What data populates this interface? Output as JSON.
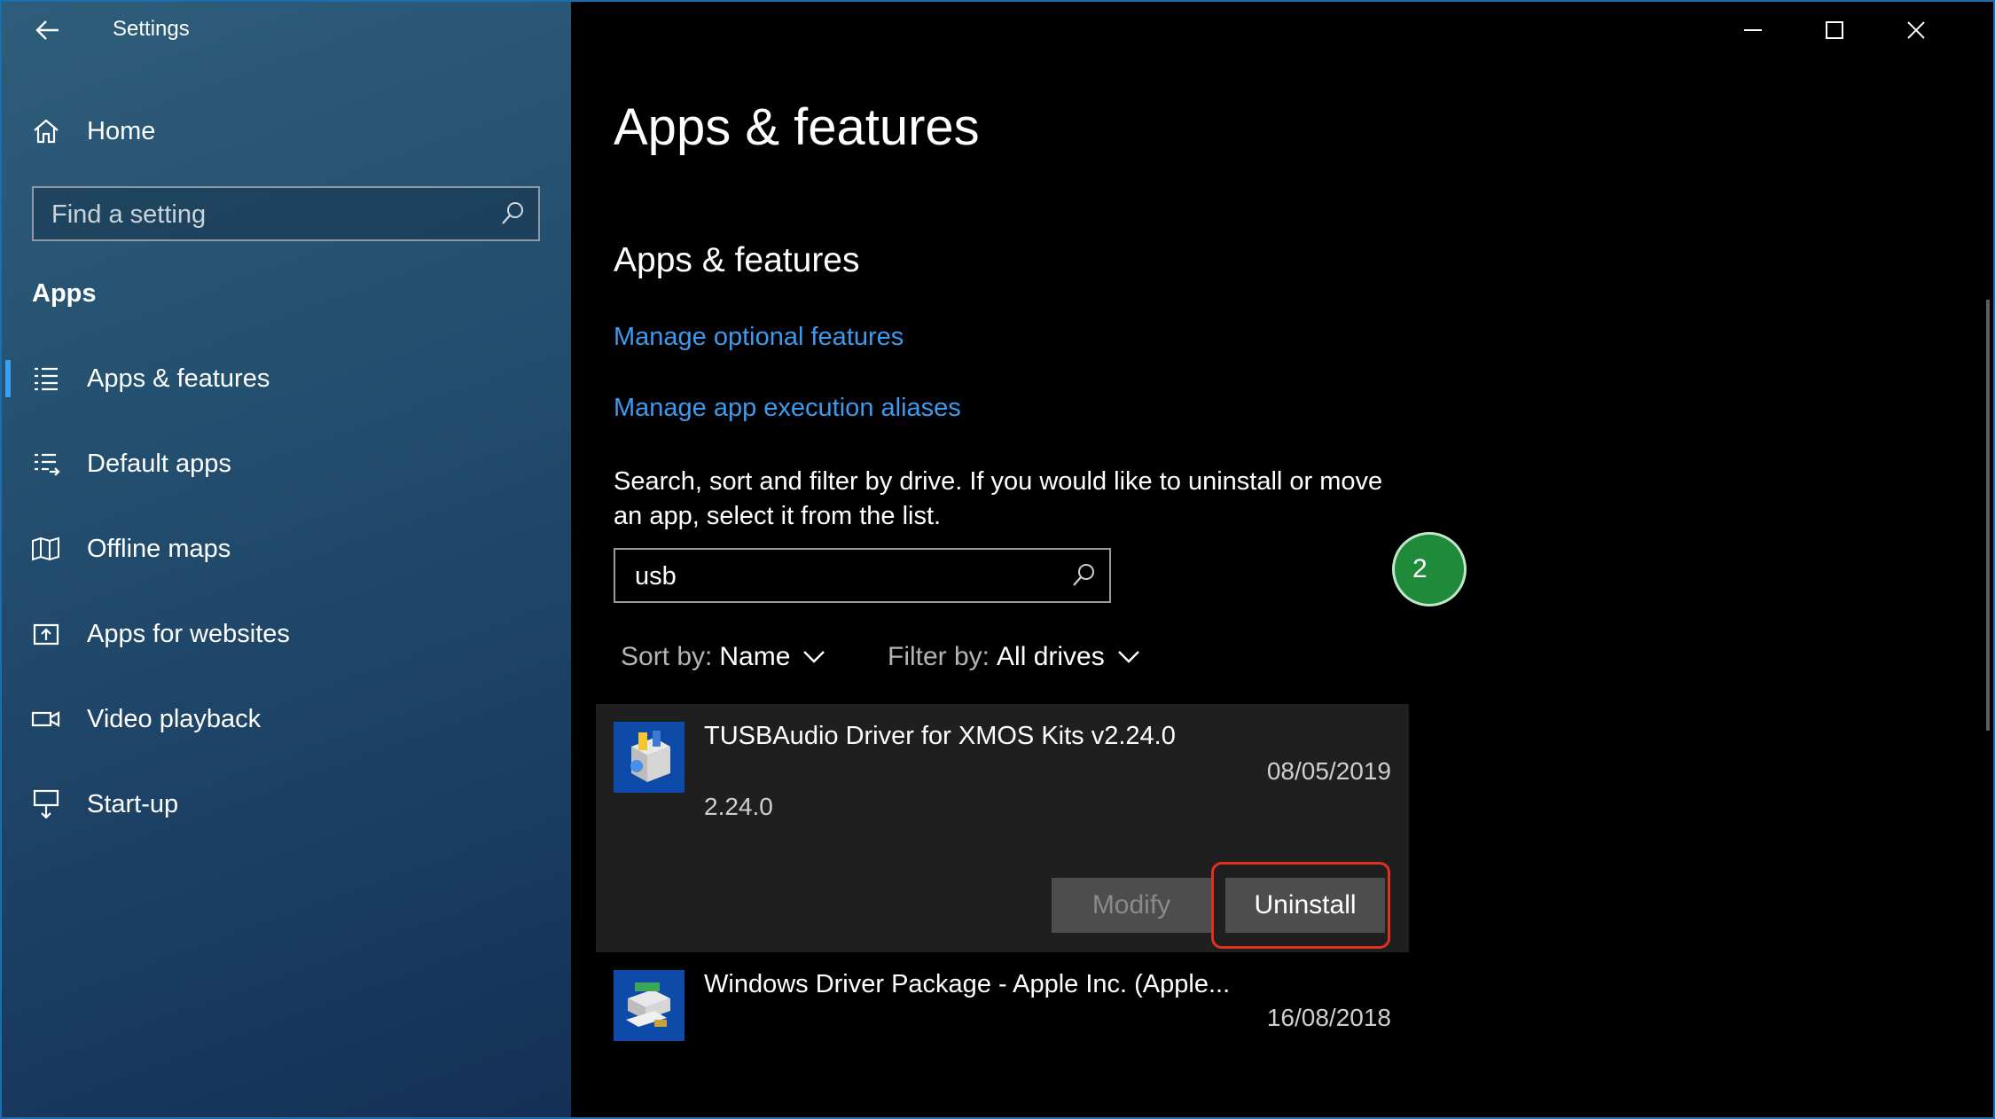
{
  "window": {
    "title": "Settings"
  },
  "sidebar": {
    "home_label": "Home",
    "search_placeholder": "Find a setting",
    "section_title": "Apps",
    "items": [
      {
        "label": "Apps & features",
        "icon": "list-icon",
        "selected": true
      },
      {
        "label": "Default apps",
        "icon": "default-apps-icon"
      },
      {
        "label": "Offline maps",
        "icon": "map-icon"
      },
      {
        "label": "Apps for websites",
        "icon": "open-in-app-icon"
      },
      {
        "label": "Video playback",
        "icon": "video-camera-icon"
      },
      {
        "label": "Start-up",
        "icon": "monitor-startup-icon"
      }
    ]
  },
  "main": {
    "page_title": "Apps & features",
    "sub_title": "Apps & features",
    "links": [
      "Manage optional features",
      "Manage app execution aliases"
    ],
    "description": "Search, sort and filter by drive. If you would like to uninstall or move an app, select it from the list.",
    "search_value": "usb",
    "sort_label": "Sort by:",
    "sort_value": "Name",
    "filter_label": "Filter by:",
    "filter_value": "All drives",
    "apps": [
      {
        "name": "TUSBAudio Driver for XMOS Kits v2.24.0",
        "date": "08/05/2019",
        "version": "2.24.0",
        "modify_label": "Modify",
        "uninstall_label": "Uninstall"
      },
      {
        "name": "Windows Driver Package - Apple Inc. (Apple...",
        "date": "16/08/2018"
      }
    ]
  },
  "badge": {
    "text": "2"
  },
  "colors": {
    "accent": "#3a9bef",
    "highlight": "#e0301e",
    "selected_bar": "#3aa0f0"
  }
}
